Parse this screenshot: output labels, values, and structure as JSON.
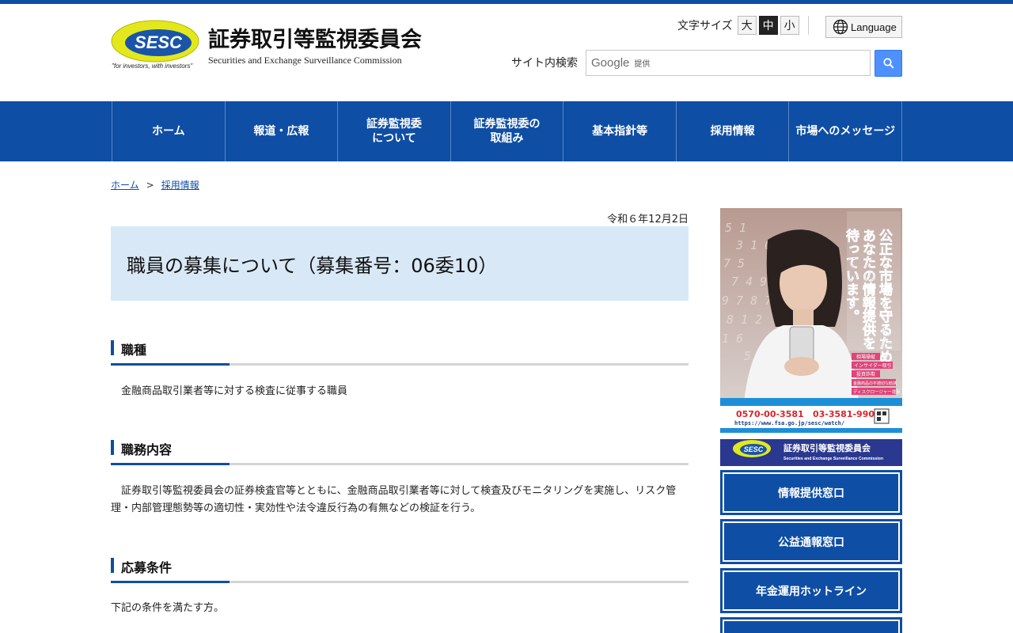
{
  "header": {
    "logo_mark": "SESC",
    "logo_tagline": "\"for investors, with investors\"",
    "org_name_ja": "証券取引等監視委員会",
    "org_name_en": "Securities and Exchange Surveillance Commission",
    "font_size_label": "文字サイズ",
    "font_size_options": [
      "大",
      "中",
      "小"
    ],
    "font_size_selected": "中",
    "language_label": "Language",
    "search_label": "サイト内検索",
    "search_brand": "Google",
    "search_brand_suffix": "提供"
  },
  "nav": {
    "items": [
      "ホーム",
      "報道・広報",
      "証券監視委\nについて",
      "証券監視委の\n取組み",
      "基本指針等",
      "採用情報",
      "市場へのメッセージ"
    ]
  },
  "breadcrumb": {
    "items": [
      "ホーム",
      "採用情報"
    ],
    "separator": ">"
  },
  "main": {
    "date": "令和６年12月2日",
    "title": "職員の募集について（募集番号：06委10）",
    "sections": [
      {
        "heading": "職種",
        "body": "　金融商品取引業者等に対する検査に従事する職員"
      },
      {
        "heading": "職務内容",
        "body": "　証券取引等監視委員会の証券検査官等とともに、金融商品取引業者等に対して検査及びモニタリングを実施し、リスク管理・内部管理態勢等の適切性・実効性や法令違反行為の有無などの検証を行う。"
      },
      {
        "heading": "応募条件",
        "body": "下記の条件を満たす方。"
      }
    ]
  },
  "sidebar": {
    "banner": {
      "headline": "公正な市場を守るため、あなたの情報提供を待っています。",
      "tags": [
        "相場操縦",
        "インサイダー取引",
        "投資詐欺",
        "金融商品の不適切な勧誘",
        "ディスクロージャー違反"
      ],
      "phone_free": "0570-00-3581",
      "phone": "03-3581-9909",
      "url": "https://www.fsa.go.jp/sesc/watch/",
      "footer_ja": "証券取引等監視委員会",
      "footer_en": "Securities and Exchange Surveillance Commission"
    },
    "buttons": [
      "情報提供窓口",
      "公益通報窓口",
      "年金運用ホットライン",
      ""
    ]
  },
  "colors": {
    "brand_blue": "#0e4ea4",
    "title_bg": "#d9e8f6",
    "search_button": "#4d90fe",
    "logo_yellow": "#e5ea1a"
  }
}
